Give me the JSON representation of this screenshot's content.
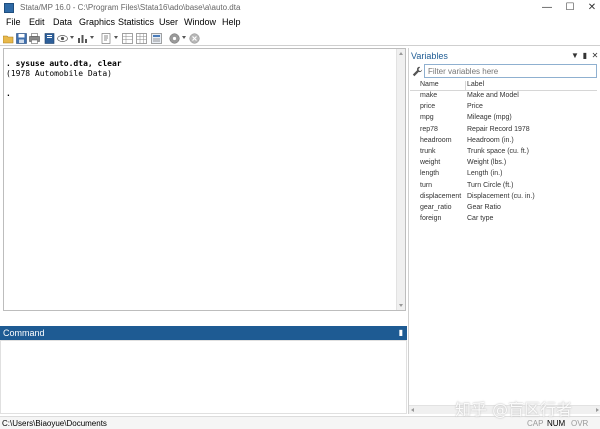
{
  "window": {
    "title": "Stata/MP 16.0 - C:\\Program Files\\Stata16\\ado\\base\\a\\auto.dta",
    "controls": [
      "minimize",
      "maximize",
      "close"
    ]
  },
  "menu": [
    "File",
    "Edit",
    "Data",
    "Graphics",
    "Statistics",
    "User",
    "Window",
    "Help"
  ],
  "toolbar": {
    "icons": [
      "open-icon",
      "save-icon",
      "print-icon",
      "log-icon",
      "viewer-icon",
      "graph-icon",
      "do-file-editor-icon",
      "data-editor-icon",
      "data-browser-icon",
      "variables-manager-icon",
      "more-icon",
      "break-icon"
    ]
  },
  "results": {
    "lines": [
      ". sysuse auto.dta, clear",
      "(1978 Automobile Data)",
      "",
      "."
    ]
  },
  "command": {
    "header": "Command"
  },
  "variables": {
    "header": "Variables",
    "filter_placeholder": "Filter variables here",
    "columns": [
      "Name",
      "Label"
    ],
    "rows": [
      {
        "name": "make",
        "label": "Make and Model"
      },
      {
        "name": "price",
        "label": "Price"
      },
      {
        "name": "mpg",
        "label": "Mileage (mpg)"
      },
      {
        "name": "rep78",
        "label": "Repair Record 1978"
      },
      {
        "name": "headroom",
        "label": "Headroom (in.)"
      },
      {
        "name": "trunk",
        "label": "Trunk space (cu. ft.)"
      },
      {
        "name": "weight",
        "label": "Weight (lbs.)"
      },
      {
        "name": "length",
        "label": "Length (in.)"
      },
      {
        "name": "turn",
        "label": "Turn Circle (ft.)"
      },
      {
        "name": "displacement",
        "label": "Displacement (cu. in.)"
      },
      {
        "name": "gear_ratio",
        "label": "Gear Ratio"
      },
      {
        "name": "foreign",
        "label": "Car type"
      }
    ]
  },
  "statusbar": {
    "path": "C:\\Users\\Biaoyue\\Documents",
    "indicators": [
      "CAP",
      "NUM",
      "OVR"
    ]
  },
  "watermark": "知乎 @盲区行者",
  "colors": {
    "accent": "#1e5b93",
    "variables_header": "#1e5b93",
    "indicator_active": "#000000",
    "indicator_inactive": "#9a9a9a"
  }
}
